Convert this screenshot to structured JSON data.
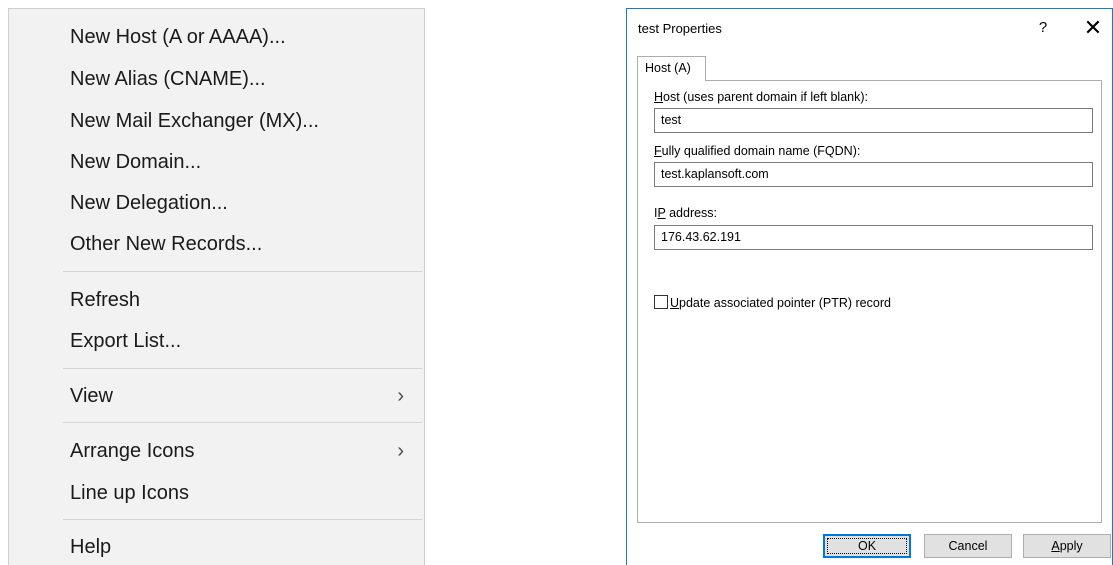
{
  "context_menu": {
    "items": [
      {
        "label": "New Host (A or AAAA)..."
      },
      {
        "label": "New Alias (CNAME)..."
      },
      {
        "label": "New Mail Exchanger (MX)..."
      },
      {
        "label": "New Domain..."
      },
      {
        "label": "New Delegation..."
      },
      {
        "label": "Other New Records..."
      },
      {
        "label": "Refresh"
      },
      {
        "label": "Export List..."
      },
      {
        "label": "View",
        "submenu_arrow": "›"
      },
      {
        "label": "Arrange Icons",
        "submenu_arrow": "›"
      },
      {
        "label": "Line up Icons"
      },
      {
        "label": "Help"
      }
    ]
  },
  "dialog": {
    "title": "test Properties",
    "help_glyph": "?",
    "close_glyph": "✕",
    "tab_label": "Host (A)",
    "host": {
      "label_accel": "H",
      "label_rest": "ost (uses parent domain if left blank):",
      "value": "test"
    },
    "fqdn": {
      "label_accel": "F",
      "label_rest": "ully qualified domain name (FQDN):",
      "value": "test.kaplansoft.com"
    },
    "ip": {
      "label_pre": "I",
      "label_accel": "P",
      "label_rest": " address:",
      "value": "176.43.62.191"
    },
    "ptr_checkbox": {
      "label_accel": "U",
      "label_rest": "pdate associated pointer (PTR) record",
      "checked": false
    },
    "buttons": {
      "ok": "OK",
      "cancel": "Cancel",
      "apply_accel": "A",
      "apply_rest": "pply"
    }
  },
  "colors": {
    "menu_bg": "#f2f2f2",
    "dialog_border": "#1979ca",
    "default_button_border": "#0078d7"
  }
}
